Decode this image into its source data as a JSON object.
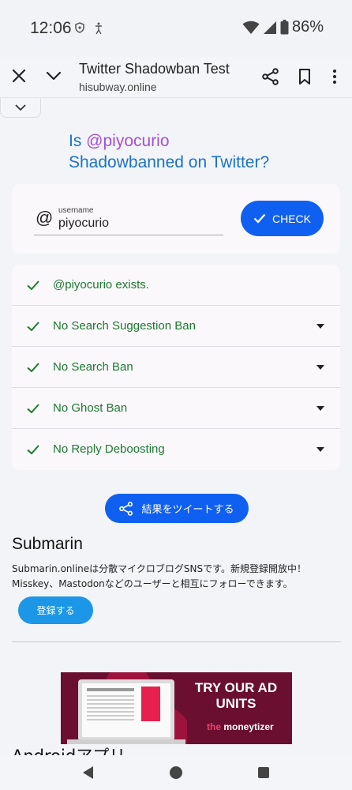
{
  "status_bar": {
    "time": "12:06",
    "battery": "86%",
    "icons": [
      "shield-icon",
      "accessibility-icon",
      "wifi-icon",
      "signal-icon",
      "battery-icon"
    ]
  },
  "toolbar": {
    "title": "Twitter Shadowban Test",
    "url": "hisubway.online"
  },
  "heading": {
    "line1_prefix": "Is ",
    "handle": "@piyocurio",
    "line2": "Shadowbanned on Twitter?"
  },
  "search": {
    "at": "@",
    "label": "username",
    "value": "piyocurio",
    "button_label": "CHECK"
  },
  "results": [
    {
      "text": "@piyocurio exists.",
      "expandable": false
    },
    {
      "text": "No Search Suggestion Ban",
      "expandable": true
    },
    {
      "text": "No Search Ban",
      "expandable": true
    },
    {
      "text": "No Ghost Ban",
      "expandable": true
    },
    {
      "text": "No Reply Deboosting",
      "expandable": true
    }
  ],
  "tweet_button": "結果をツイートする",
  "promo": {
    "title": "Submarin",
    "desc_line1": "Submarin.onlineは分散マイクロブログSNSです。新規登録開放中！",
    "desc_line2": "Misskey、Mastodonなどのユーザーと相互にフォローできます。",
    "register": "登録する"
  },
  "ad": {
    "headline": "TRY OUR AD UNITS",
    "brand_the": "the",
    "brand_name": "moneytizer"
  },
  "android_heading": "Androidアプリ",
  "colors": {
    "accent_blue": "#0f60f0",
    "heading_blue": "#1a73c8",
    "handle_purple": "#a44fd4",
    "success_green": "#1b7a2e",
    "register_blue": "#1c97e8",
    "ad_background": "#6a0f2f"
  }
}
